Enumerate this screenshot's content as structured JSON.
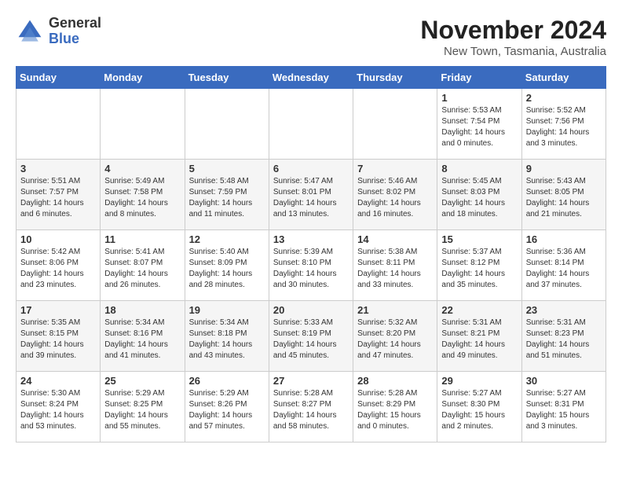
{
  "logo": {
    "general": "General",
    "blue": "Blue"
  },
  "title": "November 2024",
  "location": "New Town, Tasmania, Australia",
  "days_of_week": [
    "Sunday",
    "Monday",
    "Tuesday",
    "Wednesday",
    "Thursday",
    "Friday",
    "Saturday"
  ],
  "weeks": [
    [
      {
        "day": "",
        "info": ""
      },
      {
        "day": "",
        "info": ""
      },
      {
        "day": "",
        "info": ""
      },
      {
        "day": "",
        "info": ""
      },
      {
        "day": "",
        "info": ""
      },
      {
        "day": "1",
        "info": "Sunrise: 5:53 AM\nSunset: 7:54 PM\nDaylight: 14 hours\nand 0 minutes."
      },
      {
        "day": "2",
        "info": "Sunrise: 5:52 AM\nSunset: 7:56 PM\nDaylight: 14 hours\nand 3 minutes."
      }
    ],
    [
      {
        "day": "3",
        "info": "Sunrise: 5:51 AM\nSunset: 7:57 PM\nDaylight: 14 hours\nand 6 minutes."
      },
      {
        "day": "4",
        "info": "Sunrise: 5:49 AM\nSunset: 7:58 PM\nDaylight: 14 hours\nand 8 minutes."
      },
      {
        "day": "5",
        "info": "Sunrise: 5:48 AM\nSunset: 7:59 PM\nDaylight: 14 hours\nand 11 minutes."
      },
      {
        "day": "6",
        "info": "Sunrise: 5:47 AM\nSunset: 8:01 PM\nDaylight: 14 hours\nand 13 minutes."
      },
      {
        "day": "7",
        "info": "Sunrise: 5:46 AM\nSunset: 8:02 PM\nDaylight: 14 hours\nand 16 minutes."
      },
      {
        "day": "8",
        "info": "Sunrise: 5:45 AM\nSunset: 8:03 PM\nDaylight: 14 hours\nand 18 minutes."
      },
      {
        "day": "9",
        "info": "Sunrise: 5:43 AM\nSunset: 8:05 PM\nDaylight: 14 hours\nand 21 minutes."
      }
    ],
    [
      {
        "day": "10",
        "info": "Sunrise: 5:42 AM\nSunset: 8:06 PM\nDaylight: 14 hours\nand 23 minutes."
      },
      {
        "day": "11",
        "info": "Sunrise: 5:41 AM\nSunset: 8:07 PM\nDaylight: 14 hours\nand 26 minutes."
      },
      {
        "day": "12",
        "info": "Sunrise: 5:40 AM\nSunset: 8:09 PM\nDaylight: 14 hours\nand 28 minutes."
      },
      {
        "day": "13",
        "info": "Sunrise: 5:39 AM\nSunset: 8:10 PM\nDaylight: 14 hours\nand 30 minutes."
      },
      {
        "day": "14",
        "info": "Sunrise: 5:38 AM\nSunset: 8:11 PM\nDaylight: 14 hours\nand 33 minutes."
      },
      {
        "day": "15",
        "info": "Sunrise: 5:37 AM\nSunset: 8:12 PM\nDaylight: 14 hours\nand 35 minutes."
      },
      {
        "day": "16",
        "info": "Sunrise: 5:36 AM\nSunset: 8:14 PM\nDaylight: 14 hours\nand 37 minutes."
      }
    ],
    [
      {
        "day": "17",
        "info": "Sunrise: 5:35 AM\nSunset: 8:15 PM\nDaylight: 14 hours\nand 39 minutes."
      },
      {
        "day": "18",
        "info": "Sunrise: 5:34 AM\nSunset: 8:16 PM\nDaylight: 14 hours\nand 41 minutes."
      },
      {
        "day": "19",
        "info": "Sunrise: 5:34 AM\nSunset: 8:18 PM\nDaylight: 14 hours\nand 43 minutes."
      },
      {
        "day": "20",
        "info": "Sunrise: 5:33 AM\nSunset: 8:19 PM\nDaylight: 14 hours\nand 45 minutes."
      },
      {
        "day": "21",
        "info": "Sunrise: 5:32 AM\nSunset: 8:20 PM\nDaylight: 14 hours\nand 47 minutes."
      },
      {
        "day": "22",
        "info": "Sunrise: 5:31 AM\nSunset: 8:21 PM\nDaylight: 14 hours\nand 49 minutes."
      },
      {
        "day": "23",
        "info": "Sunrise: 5:31 AM\nSunset: 8:23 PM\nDaylight: 14 hours\nand 51 minutes."
      }
    ],
    [
      {
        "day": "24",
        "info": "Sunrise: 5:30 AM\nSunset: 8:24 PM\nDaylight: 14 hours\nand 53 minutes."
      },
      {
        "day": "25",
        "info": "Sunrise: 5:29 AM\nSunset: 8:25 PM\nDaylight: 14 hours\nand 55 minutes."
      },
      {
        "day": "26",
        "info": "Sunrise: 5:29 AM\nSunset: 8:26 PM\nDaylight: 14 hours\nand 57 minutes."
      },
      {
        "day": "27",
        "info": "Sunrise: 5:28 AM\nSunset: 8:27 PM\nDaylight: 14 hours\nand 58 minutes."
      },
      {
        "day": "28",
        "info": "Sunrise: 5:28 AM\nSunset: 8:29 PM\nDaylight: 15 hours\nand 0 minutes."
      },
      {
        "day": "29",
        "info": "Sunrise: 5:27 AM\nSunset: 8:30 PM\nDaylight: 15 hours\nand 2 minutes."
      },
      {
        "day": "30",
        "info": "Sunrise: 5:27 AM\nSunset: 8:31 PM\nDaylight: 15 hours\nand 3 minutes."
      }
    ]
  ]
}
